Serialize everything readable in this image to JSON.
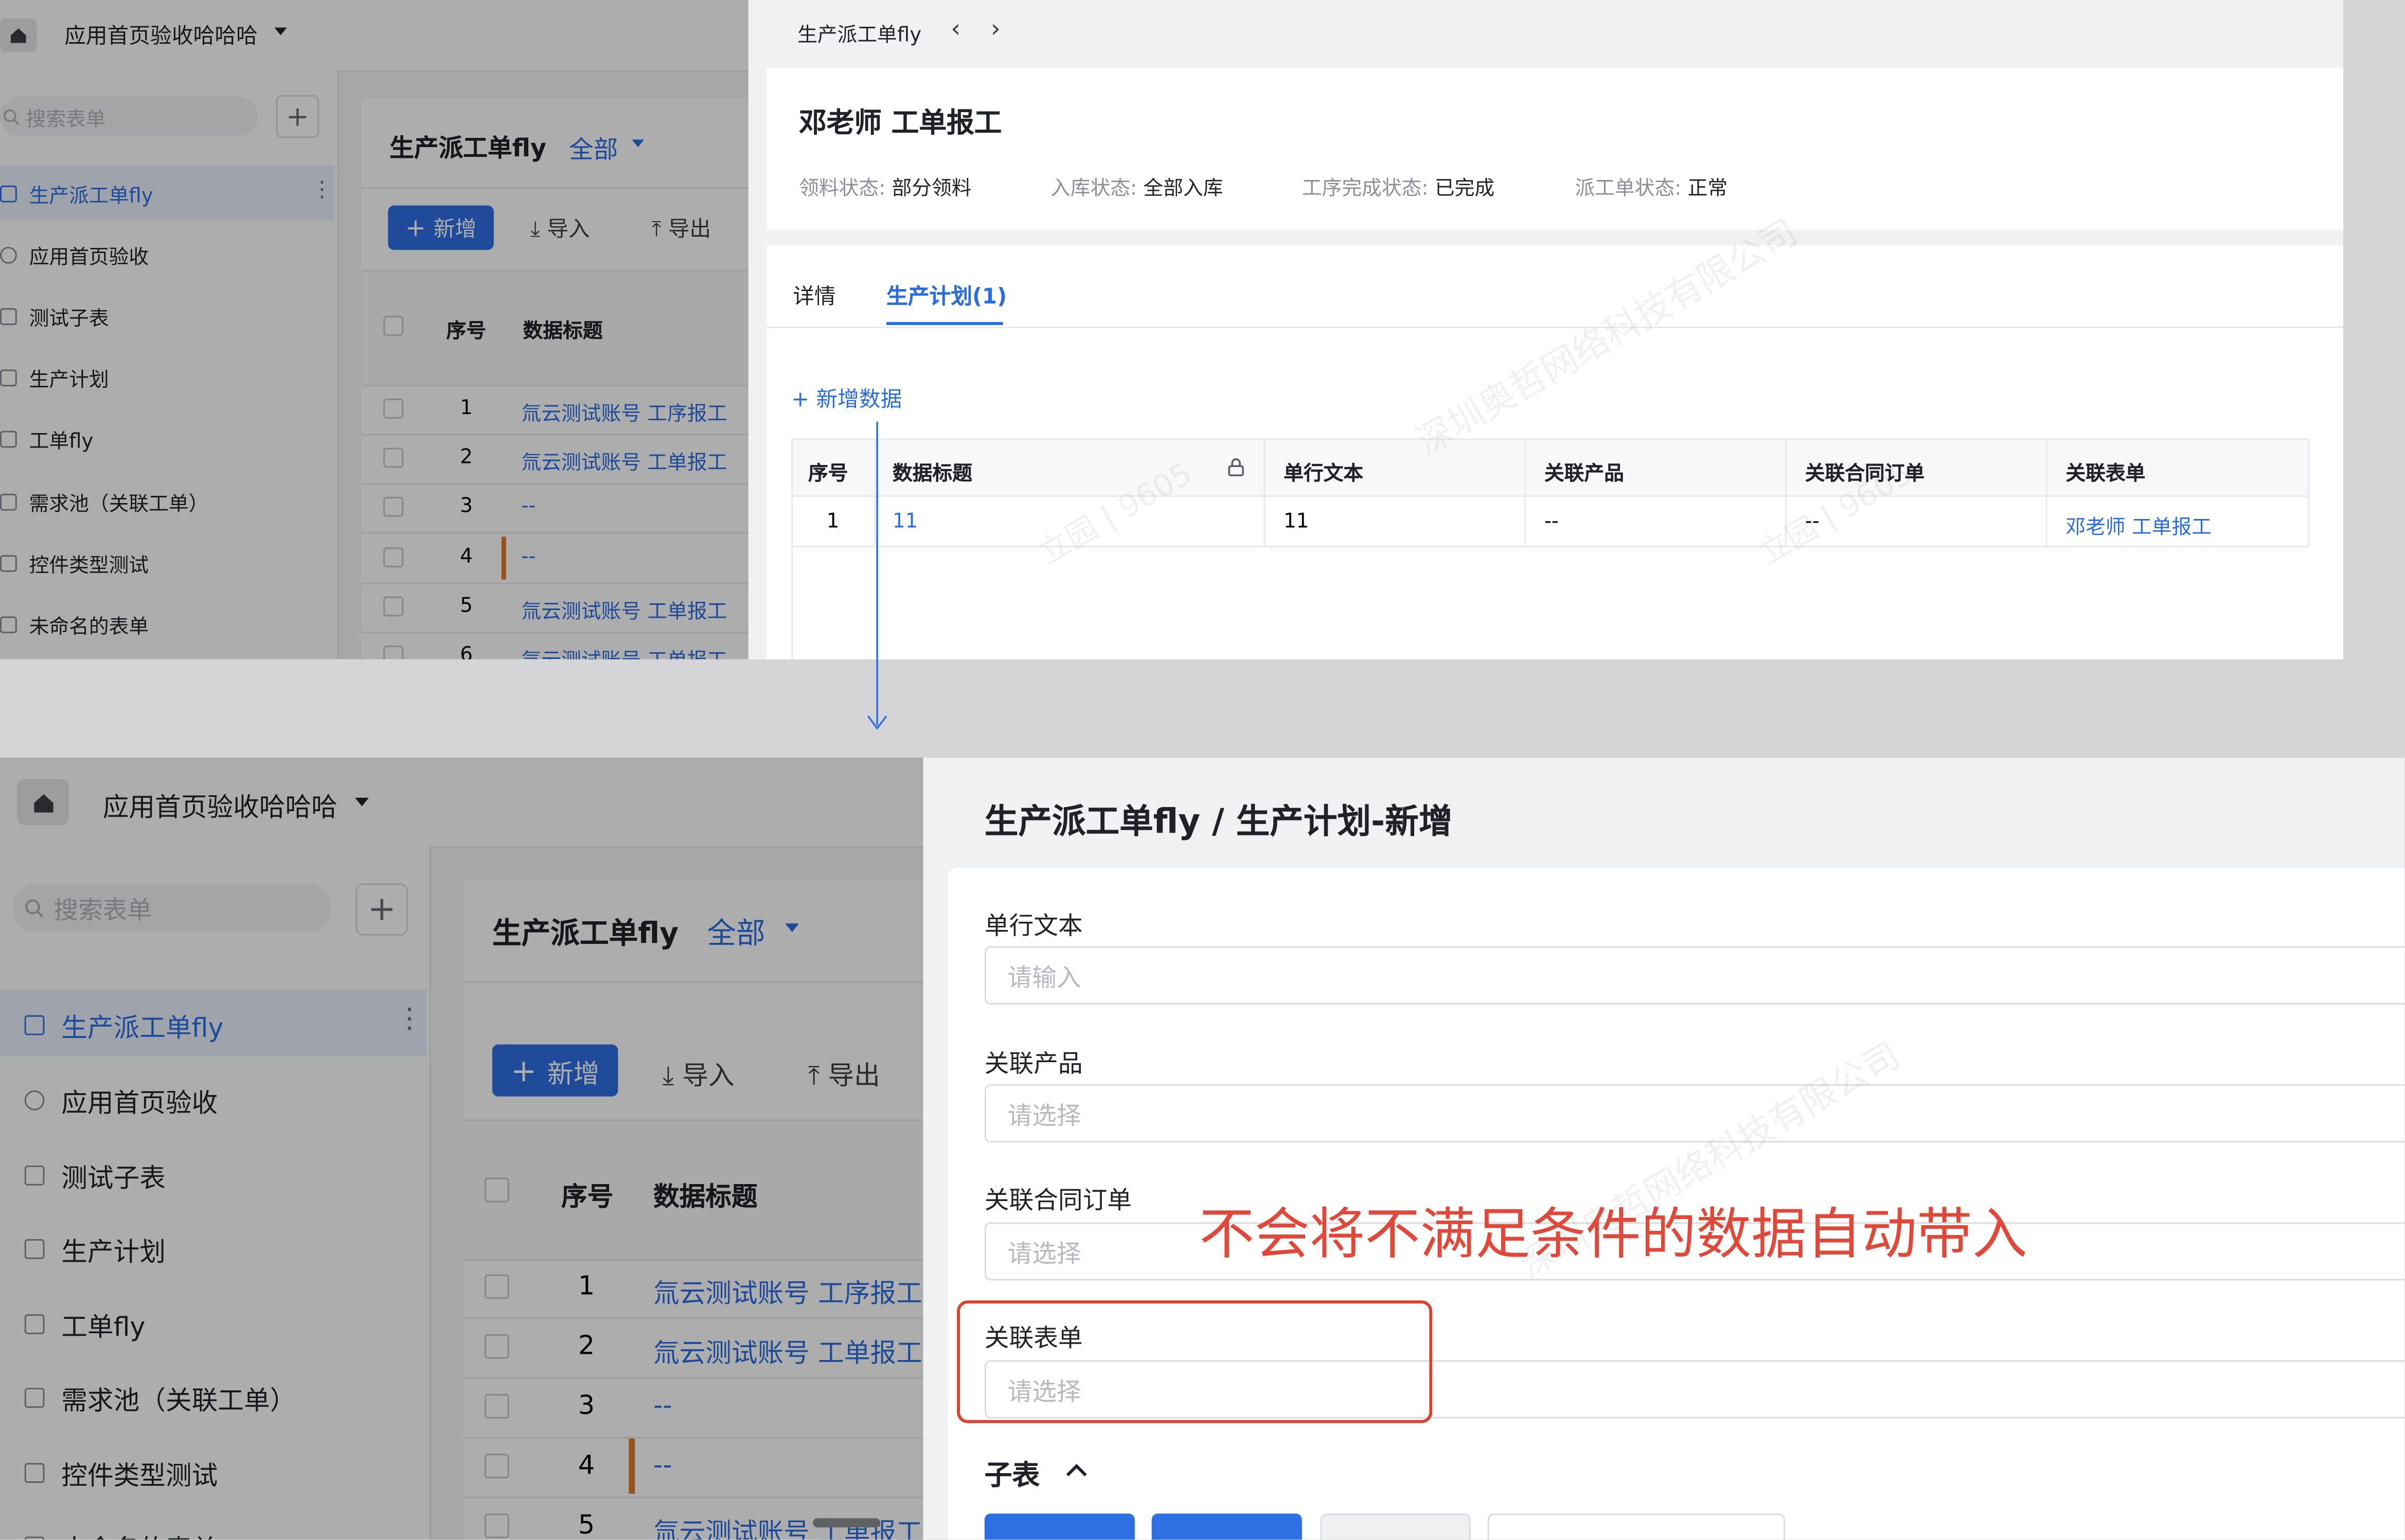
{
  "top": {
    "app_title": "应用首页验收哈哈哈",
    "search_placeholder": "搜索表单",
    "sidebar_items": [
      {
        "label": "生产派工单fly",
        "active": true
      },
      {
        "label": "应用首页验收"
      },
      {
        "label": "测试子表"
      },
      {
        "label": "生产计划"
      },
      {
        "label": "工单fly"
      },
      {
        "label": "需求池（关联工单）"
      },
      {
        "label": "控件类型测试"
      },
      {
        "label": "未命名的表单"
      }
    ],
    "list_title": "生产派工单fly",
    "list_filter": "全部",
    "btn_new": "新增",
    "btn_import": "导入",
    "btn_export": "导出",
    "col_seq": "序号",
    "col_title": "数据标题",
    "rows": [
      {
        "seq": "1",
        "title": "氚云测试账号 工序报工"
      },
      {
        "seq": "2",
        "title": "氚云测试账号 工单报工"
      },
      {
        "seq": "3",
        "title": "--"
      },
      {
        "seq": "4",
        "title": "--"
      },
      {
        "seq": "5",
        "title": "氚云测试账号 工单报工"
      },
      {
        "seq": "6",
        "title": "氚云测试账号 工单报工"
      }
    ],
    "detail": {
      "breadcrumb": "生产派工单fly",
      "title": "邓老师 工单报工",
      "statuses": [
        {
          "label": "领料状态:",
          "value": "部分领料"
        },
        {
          "label": "入库状态:",
          "value": "全部入库"
        },
        {
          "label": "工序完成状态:",
          "value": "已完成"
        },
        {
          "label": "派工单状态:",
          "value": "正常"
        }
      ],
      "tab_detail": "详情",
      "tab_plan": "生产计划(1)",
      "add_data": "新增数据",
      "sub_cols": [
        "序号",
        "数据标题",
        "单行文本",
        "关联产品",
        "关联合同订单",
        "关联表单"
      ],
      "sub_row": [
        "1",
        "11",
        "11",
        "--",
        "--",
        "邓老师 工单报工"
      ]
    }
  },
  "bottom": {
    "app_title": "应用首页验收哈哈哈",
    "search_placeholder": "搜索表单",
    "sidebar_items": [
      {
        "label": "生产派工单fly",
        "active": true
      },
      {
        "label": "应用首页验收"
      },
      {
        "label": "测试子表"
      },
      {
        "label": "生产计划"
      },
      {
        "label": "工单fly"
      },
      {
        "label": "需求池（关联工单）"
      },
      {
        "label": "控件类型测试"
      },
      {
        "label": "未命名的表单"
      }
    ],
    "list_title": "生产派工单fly",
    "list_filter": "全部",
    "btn_new": "新增",
    "btn_import": "导入",
    "btn_export": "导出",
    "col_seq": "序号",
    "col_title": "数据标题",
    "rows": [
      {
        "seq": "1",
        "title": "氚云测试账号 工序报工"
      },
      {
        "seq": "2",
        "title": "氚云测试账号 工单报工"
      },
      {
        "seq": "3",
        "title": "--"
      },
      {
        "seq": "4",
        "title": "--"
      },
      {
        "seq": "5",
        "title": "氚云测试账号 工单报工"
      }
    ],
    "form": {
      "title": "生产派工单fly / 生产计划-新增",
      "fields": [
        {
          "label": "单行文本",
          "placeholder": "请输入"
        },
        {
          "label": "关联产品",
          "placeholder": "请选择"
        },
        {
          "label": "关联合同订单",
          "placeholder": "请选择"
        },
        {
          "label": "关联表单",
          "placeholder": "请选择"
        }
      ],
      "subtable_label": "子表"
    },
    "annotation": "不会将不满足条件的数据自动带入",
    "annotation_color": "#e0483a"
  },
  "watermarks": [
    "深圳奥哲网络科技有限公司",
    "立园 | 9605"
  ],
  "colors": {
    "accent": "#2f6fe4",
    "link": "#2a6de0",
    "highlight_border": "#d9432f"
  }
}
